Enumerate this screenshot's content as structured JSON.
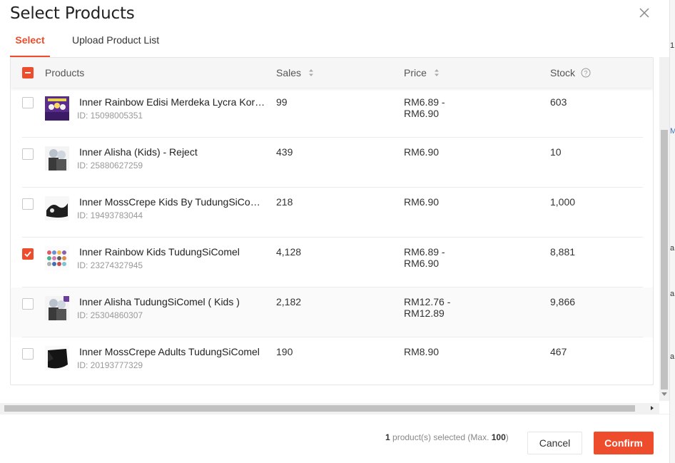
{
  "modal": {
    "title": "Select Products"
  },
  "tabs": [
    {
      "label": "Select",
      "active": true
    },
    {
      "label": "Upload Product List",
      "active": false
    }
  ],
  "table": {
    "columns": {
      "products": "Products",
      "sales": "Sales",
      "price": "Price",
      "stock": "Stock"
    },
    "rows": [
      {
        "name": "Inner Rainbow Edisi Merdeka Lycra Korea Tudungsicomel",
        "id": "ID: 15098005351",
        "sales": "99",
        "price_line1": "RM6.89 -",
        "price_line2": "RM6.90",
        "stock": "603",
        "selected": false
      },
      {
        "name": "Inner Alisha (Kids) - Reject",
        "id": "ID: 25880627259",
        "sales": "439",
        "price_line1": "RM6.90",
        "price_line2": "",
        "stock": "10",
        "selected": false
      },
      {
        "name": "Inner MossCrepe Kids By TudungSiComel",
        "id": "ID: 19493783044",
        "sales": "218",
        "price_line1": "RM6.90",
        "price_line2": "",
        "stock": "1,000",
        "selected": false
      },
      {
        "name": "Inner Rainbow Kids TudungSiComel",
        "id": "ID: 23274327945",
        "sales": "4,128",
        "price_line1": "RM6.89 -",
        "price_line2": "RM6.90",
        "stock": "8,881",
        "selected": true
      },
      {
        "name": "Inner Alisha TudungSiComel ( Kids )",
        "id": "ID: 25304860307",
        "sales": "2,182",
        "price_line1": "RM12.76 -",
        "price_line2": "RM12.89",
        "stock": "9,866",
        "selected": false
      },
      {
        "name": "Inner MossCrepe Adults TudungSiComel",
        "id": "ID: 20193777329",
        "sales": "190",
        "price_line1": "RM8.90",
        "price_line2": "",
        "stock": "467",
        "selected": false
      }
    ]
  },
  "footer": {
    "selected_count": "1",
    "selected_text": " product(s) selected (Max. ",
    "max": "100",
    "close_paren": ")",
    "cancel_label": "Cancel",
    "confirm_label": "Confirm"
  },
  "background_fragments": [
    "1",
    "M",
    "a",
    "a",
    "a"
  ],
  "colors": {
    "accent": "#ee4d2d"
  }
}
